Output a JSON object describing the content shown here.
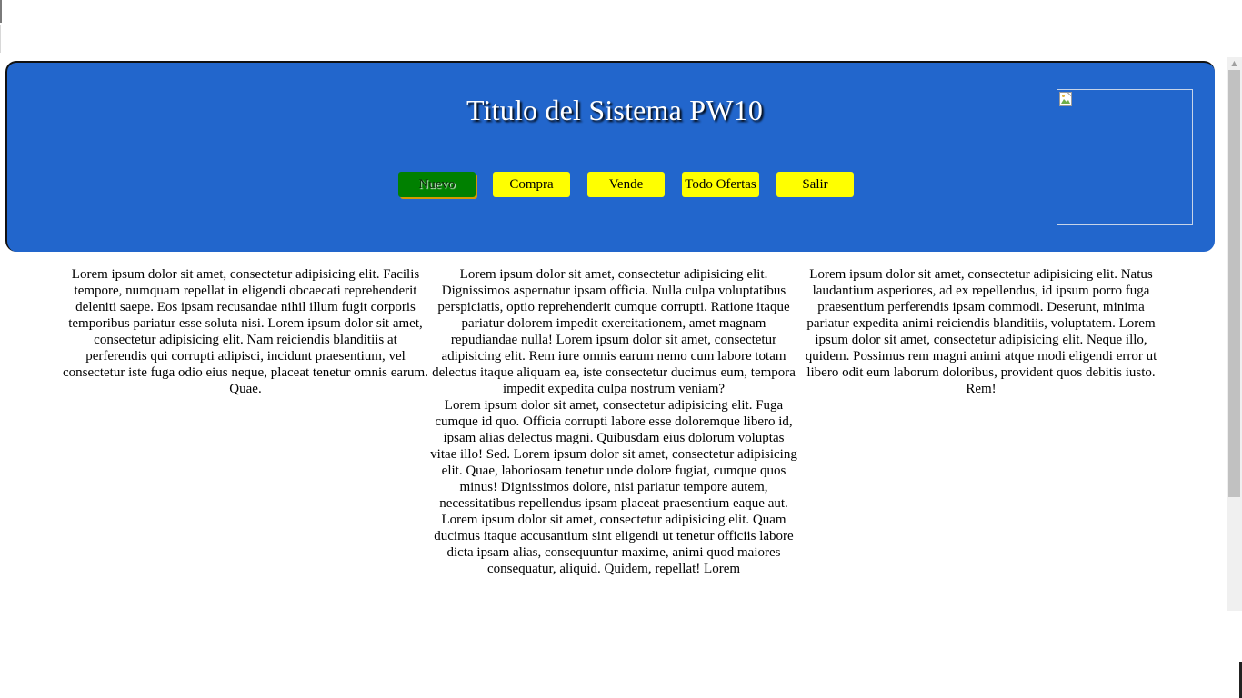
{
  "header": {
    "title": "Titulo del Sistema PW10",
    "image_alt": "",
    "background_color": "#2266cc"
  },
  "nav": {
    "items": [
      {
        "label": "Nuevo",
        "active": true
      },
      {
        "label": "Compra",
        "active": false
      },
      {
        "label": "Vende",
        "active": false
      },
      {
        "label": "Todo Ofertas",
        "active": false
      },
      {
        "label": "Salir",
        "active": false
      }
    ],
    "button_color": "#ffff00",
    "active_color": "#008000"
  },
  "content": {
    "col1": {
      "p1": "Lorem ipsum dolor sit amet, consectetur adipisicing elit. Facilis tempore, numquam repellat in eligendi obcaecati reprehenderit deleniti saepe. Eos ipsam recusandae nihil illum fugit corporis temporibus pariatur esse soluta nisi. Lorem ipsum dolor sit amet, consectetur adipisicing elit. Nam reiciendis blanditiis at perferendis qui corrupti adipisci, incidunt praesentium, vel consectetur iste fuga odio eius neque, placeat tenetur omnis earum. Quae."
    },
    "col2": {
      "p1": "Lorem ipsum dolor sit amet, consectetur adipisicing elit. Dignissimos aspernatur ipsam officia. Nulla culpa voluptatibus perspiciatis, optio reprehenderit cumque corrupti. Ratione itaque pariatur dolorem impedit exercitationem, amet magnam repudiandae nulla! Lorem ipsum dolor sit amet, consectetur adipisicing elit. Rem iure omnis earum nemo cum labore totam delectus itaque aliquam ea, iste consectetur ducimus eum, tempora impedit expedita culpa nostrum veniam?",
      "p2": "Lorem ipsum dolor sit amet, consectetur adipisicing elit. Fuga cumque id quo. Officia corrupti labore esse doloremque libero id, ipsam alias delectus magni. Quibusdam eius dolorum voluptas vitae illo! Sed. Lorem ipsum dolor sit amet, consectetur adipisicing elit. Quae, laboriosam tenetur unde dolore fugiat, cumque quos minus! Dignissimos dolore, nisi pariatur tempore autem, necessitatibus repellendus ipsam placeat praesentium eaque aut.",
      "p3": "Lorem ipsum dolor sit amet, consectetur adipisicing elit. Quam ducimus itaque accusantium sint eligendi ut tenetur officiis labore dicta ipsam alias, consequuntur maxime, animi quod maiores consequatur, aliquid. Quidem, repellat! Lorem"
    },
    "col3": {
      "p1": "Lorem ipsum dolor sit amet, consectetur adipisicing elit. Natus laudantium asperiores, ad ex repellendus, id ipsum porro fuga praesentium perferendis ipsam commodi. Deserunt, minima pariatur expedita animi reiciendis blanditiis, voluptatem. Lorem ipsum dolor sit amet, consectetur adipisicing elit. Neque illo, quidem. Possimus rem magni animi atque modi eligendi error ut libero odit eum laborum doloribus, provident quos debitis iusto. Rem!"
    }
  }
}
